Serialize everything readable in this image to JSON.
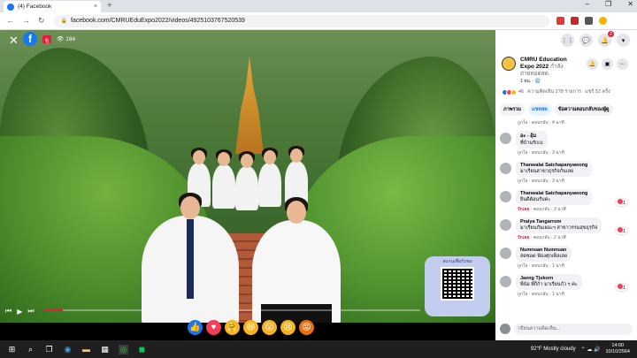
{
  "browser": {
    "tab_title": "(4) Facebook",
    "tab_close": "×",
    "new_tab": "+",
    "window_controls": [
      "–",
      "❐",
      "✕"
    ],
    "url": "facebook.com/CMRUEduExpo2022/videos/4925103767520539",
    "nav": [
      "←",
      "→",
      "↻"
    ]
  },
  "video": {
    "close": "✕",
    "logo": "f",
    "live_badge": "ดู",
    "viewers": "184",
    "qr_caption": "สแกนเพื่อรับชม",
    "controls_left": [
      "⏮",
      "▶",
      "⏭"
    ],
    "controls_right": [
      "⚙",
      "⤢",
      "⛶",
      "🔊"
    ],
    "progress": 0.05
  },
  "reactions": [
    {
      "name": "like",
      "glyph": "👍",
      "color": "#1877f2"
    },
    {
      "name": "love",
      "glyph": "♥",
      "color": "#f33e58"
    },
    {
      "name": "care",
      "glyph": "🤗",
      "color": "#f7b125"
    },
    {
      "name": "haha",
      "glyph": "😆",
      "color": "#f7b125"
    },
    {
      "name": "wow",
      "glyph": "😮",
      "color": "#f7b125"
    },
    {
      "name": "sad",
      "glyph": "😢",
      "color": "#f7b125"
    },
    {
      "name": "angry",
      "glyph": "😡",
      "color": "#e9710f"
    }
  ],
  "panel": {
    "top_icons": [
      "⋮⋮",
      "💬",
      "🔔",
      "▾"
    ],
    "notification_count": "2",
    "page_name": "CMRU Education Expo 2022",
    "page_sub": "กำลังถ่ายทอดสด",
    "page_time": "1 ชม. · 🌐",
    "reactions_count": "46",
    "comments_count": "ความคิดเห็น 278 รายการ",
    "shares_count": "แชร์ 52 ครั้ง",
    "tabs": [
      "ภาพรวม",
      "แชทสด",
      "ข้อความตอบกลับของผู้ดู"
    ],
    "comments": [
      {
        "author": "",
        "text": "",
        "meta_red": "",
        "meta": "ถูกใจ · ตอบกลับ · 4 นาที",
        "likes": ""
      },
      {
        "author": "อะ - อุ้ม",
        "text": "ที่บ้านรักเบ",
        "meta_red": "",
        "meta": "ถูกใจ · ตอบกลับ · 3 นาที",
        "likes": ""
      },
      {
        "author": "Thanwalai Satchapanyawong",
        "text": "มาเรียนสาขาธุรกิจกันเลย",
        "meta_red": "",
        "meta": "ถูกใจ · ตอบกลับ · 3 นาที",
        "likes": ""
      },
      {
        "author": "Thanwalai Satchapanyawong",
        "text": "ยินดีต้อนรับค่ะ",
        "meta_red": "รักเลย",
        "meta": " · ตอบกลับ · 3 นาที",
        "likes": "1"
      },
      {
        "author": "Praiya Tangarrom",
        "text": "มาเรียนกันเยอะๆ สาขาวรรมสุขธุรกิจ",
        "meta_red": "รักเลย",
        "meta": " · ตอบกลับ · 2 นาที",
        "likes": "1"
      },
      {
        "author": "Numnuan Numnuan",
        "text": "สดชอด ฟ้องศุกเพ็ลเลย",
        "meta_red": "",
        "meta": "ถูกใจ · ตอบกลับ · 1 นาที",
        "likes": ""
      },
      {
        "author": "Jaeng Tjskorn",
        "text": "พี่น้อ พี่ก็ก้า มาเรียนกัว ๆ ค่ะ",
        "meta_red": "",
        "meta": "ถูกใจ · ตอบกลับ · 1 นาที",
        "likes": "1"
      }
    ],
    "write_placeholder": "เขียนความคิดเห็น..."
  },
  "taskbar": {
    "weather": "92°F  Mostly cloudy",
    "time": "14:00",
    "date": "10/10/2564"
  }
}
